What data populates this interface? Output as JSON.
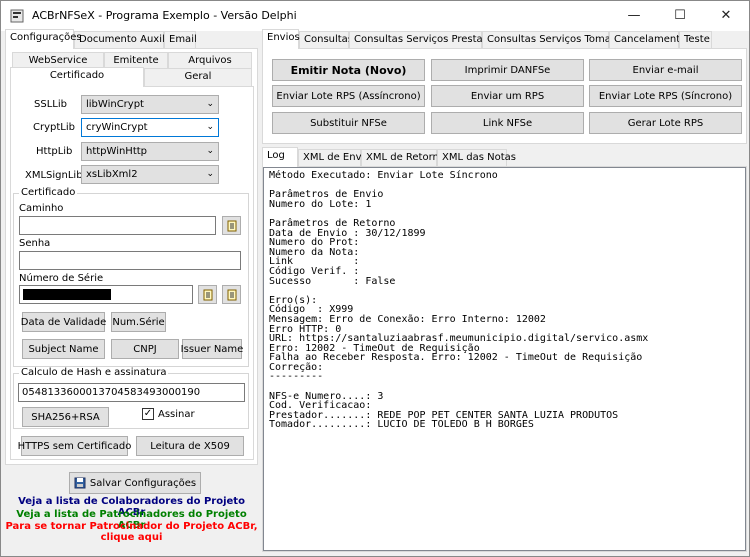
{
  "window": {
    "title": "ACBrNFSeX - Programa Exemplo - Versão Delphi",
    "minimize": "—",
    "maximize": "☐",
    "close": "✕"
  },
  "left_tabs": [
    "Configurações",
    "Documento Auxiliar",
    "Email"
  ],
  "config_tabs_row1": [
    "WebService",
    "Emitente",
    "Arquivos"
  ],
  "config_tabs_row2": [
    "Certificado",
    "Geral"
  ],
  "certificado": {
    "ssllib_label": "SSLLib",
    "ssllib_value": "libWinCrypt",
    "cryptlib_label": "CryptLib",
    "cryptlib_value": "cryWinCrypt",
    "httplib_label": "HttpLib",
    "httplib_value": "httpWinHttp",
    "xmlsignlib_label": "XMLSignLib",
    "xmlsignlib_value": "xsLibXml2",
    "group_title": "Certificado",
    "caminho_label": "Caminho",
    "caminho_value": "",
    "senha_label": "Senha",
    "senha_value": "",
    "numero_serie_label": "Número de Série",
    "buttons": {
      "data_validade": "Data de Validade",
      "num_serie": "Num.Série",
      "subject_name": "Subject Name",
      "cnpj": "CNPJ",
      "issuer_name": "Issuer Name"
    },
    "hash_group_title": "Calculo de Hash e assinatura",
    "hash_value": "0548133600013704583493000190",
    "sha_button": "SHA256+RSA",
    "assinar_label": "Assinar",
    "assinar_checked": true,
    "https_button": "HTTPS sem Certificado",
    "leitura_button": "Leitura de X509"
  },
  "salvar_button": "Salvar Configurações",
  "links": {
    "colaboradores": "Veja a lista de Colaboradores do Projeto ACBr",
    "patrocinadores": "Veja a lista de Patrocinadores do Projeto ACBr",
    "tornar_patrocinador_1": "Para se tornar Patrocinador do Projeto ACBr,",
    "tornar_patrocinador_2": "clique aqui",
    "colors": {
      "blue": "#000080",
      "green": "#008000",
      "red": "#ff0000"
    }
  },
  "right_tabs": [
    "Envios",
    "Consultas",
    "Consultas Serviços Prestados",
    "Consultas Serviços Tomados",
    "Cancelamento",
    "Teste"
  ],
  "envios_buttons": {
    "emitir_nota": "Emitir Nota (Novo)",
    "imprimir_danfse": "Imprimir DANFSe",
    "enviar_email": "Enviar e-mail",
    "enviar_lote_assincrono": "Enviar Lote RPS (Assíncrono)",
    "enviar_um_rps": "Enviar um RPS",
    "enviar_lote_sincrono": "Enviar Lote RPS (Síncrono)",
    "substituir_nfse": "Substituir NFSe",
    "link_nfse": "Link NFSe",
    "gerar_lote_rps": "Gerar Lote RPS"
  },
  "log_tabs": [
    "Log",
    "XML de Envio",
    "XML de Retorno",
    "XML das Notas"
  ],
  "log_lines": [
    "Método Executado: Enviar Lote Síncrono",
    "",
    "Parâmetros de Envio",
    "Numero do Lote: 1",
    "",
    "Parâmetros de Retorno",
    "Data de Envio : 30/12/1899",
    "Numero do Prot:",
    "Numero da Nota:",
    "Link          :",
    "Código Verif. :",
    "Sucesso       : False",
    "",
    "Erro(s):",
    "Código  : X999",
    "Mensagem: Erro de Conexão: Erro Interno: 12002",
    "Erro HTTP: 0",
    "URL: https://santaluziaabrasf.meumunicipio.digital/servico.asmx",
    "Erro: 12002 - TimeOut de Requisição",
    "Falha ao Receber Resposta. Erro: 12002 - TimeOut de Requisição",
    "Correção:",
    "---------",
    "",
    "NFS-e Numero....: 3",
    "Cod. Verificacao:",
    "Prestador.......: REDE POP PET CENTER SANTA LUZIA PRODUTOS",
    "Tomador.........: LUCIO DE TOLEDO B H BORGES"
  ]
}
